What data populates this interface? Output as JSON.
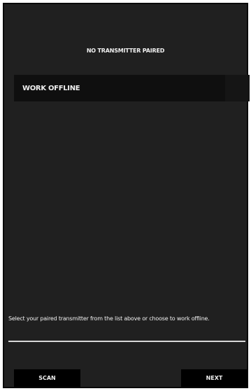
{
  "header": {
    "title": "NO TRANSMITTER PAIRED"
  },
  "transmitter_list": {
    "items": [
      {
        "label": "WORK OFFLINE"
      }
    ]
  },
  "instructions": "Select your paired transmitter from the list above or choose to work offline.",
  "footer": {
    "scan_label": "SCAN",
    "next_label": "NEXT"
  }
}
